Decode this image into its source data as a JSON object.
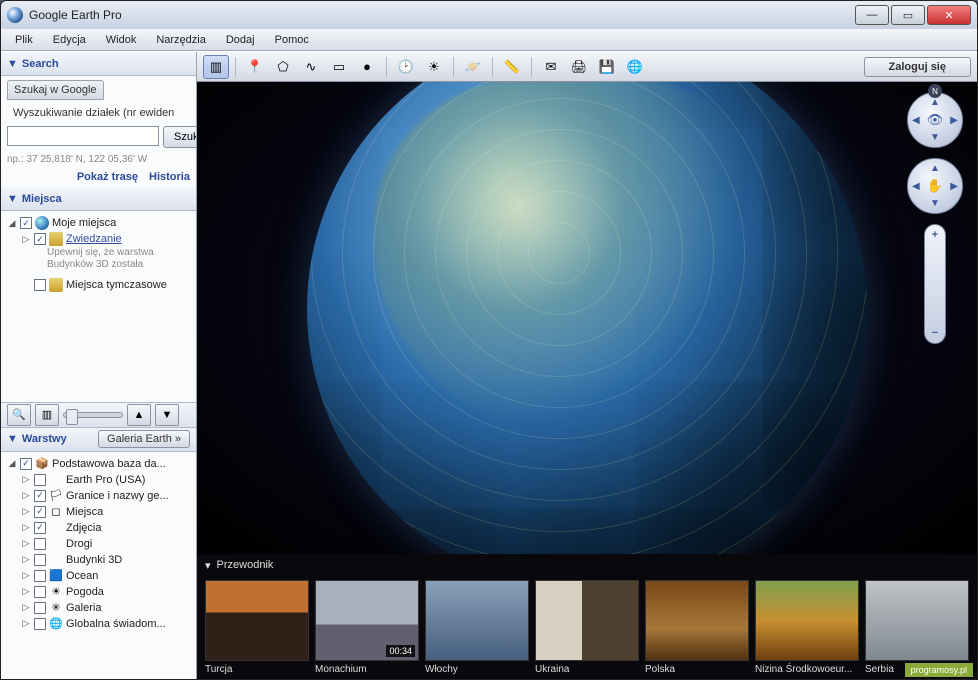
{
  "window": {
    "title": "Google Earth Pro"
  },
  "menu": [
    "Plik",
    "Edycja",
    "Widok",
    "Narzędzia",
    "Dodaj",
    "Pomoc"
  ],
  "search": {
    "panel_title": "Search",
    "tab1": "Szukaj w Google",
    "tab2": "Wyszukiwanie działek (nr ewiden",
    "button": "Szukaj",
    "hint": "np.: 37 25,818' N, 122 05,36' W",
    "route": "Pokaż trasę",
    "history": "Historia"
  },
  "places": {
    "panel_title": "Miejsca",
    "my_places": "Moje miejsca",
    "tour": "Zwiedzanie",
    "note1": "Upewnij się, że warstwa",
    "note2": "Budynków 3D została",
    "temp": "Miejsca tymczasowe"
  },
  "layers": {
    "panel_title": "Warstwy",
    "gallery": "Galeria Earth »",
    "items": [
      {
        "label": "Podstawowa baza da...",
        "checked": true,
        "icon": "📦"
      },
      {
        "label": "Earth Pro (USA)",
        "checked": false,
        "icon": ""
      },
      {
        "label": "Granice i nazwy ge...",
        "checked": true,
        "icon": "🏳"
      },
      {
        "label": "Miejsca",
        "checked": true,
        "icon": "◻"
      },
      {
        "label": "Zdjęcia",
        "checked": true,
        "icon": ""
      },
      {
        "label": "Drogi",
        "checked": false,
        "icon": ""
      },
      {
        "label": "Budynki 3D",
        "checked": false,
        "icon": ""
      },
      {
        "label": "Ocean",
        "checked": false,
        "icon": "🟦"
      },
      {
        "label": "Pogoda",
        "checked": false,
        "icon": "☀"
      },
      {
        "label": "Galeria",
        "checked": false,
        "icon": "✳"
      },
      {
        "label": "Globalna świadom...",
        "checked": false,
        "icon": "🌐"
      }
    ]
  },
  "toolbar": {
    "login": "Zaloguj się"
  },
  "nav": {
    "north": "N"
  },
  "guide": {
    "title": "Przewodnik",
    "duration": "00:34",
    "thumbs": [
      "Turcja",
      "Monachium",
      "Włochy",
      "Ukraina",
      "Polska",
      "Nizina Środkowoeur...",
      "Serbia"
    ]
  },
  "watermark": "programosy.pl"
}
